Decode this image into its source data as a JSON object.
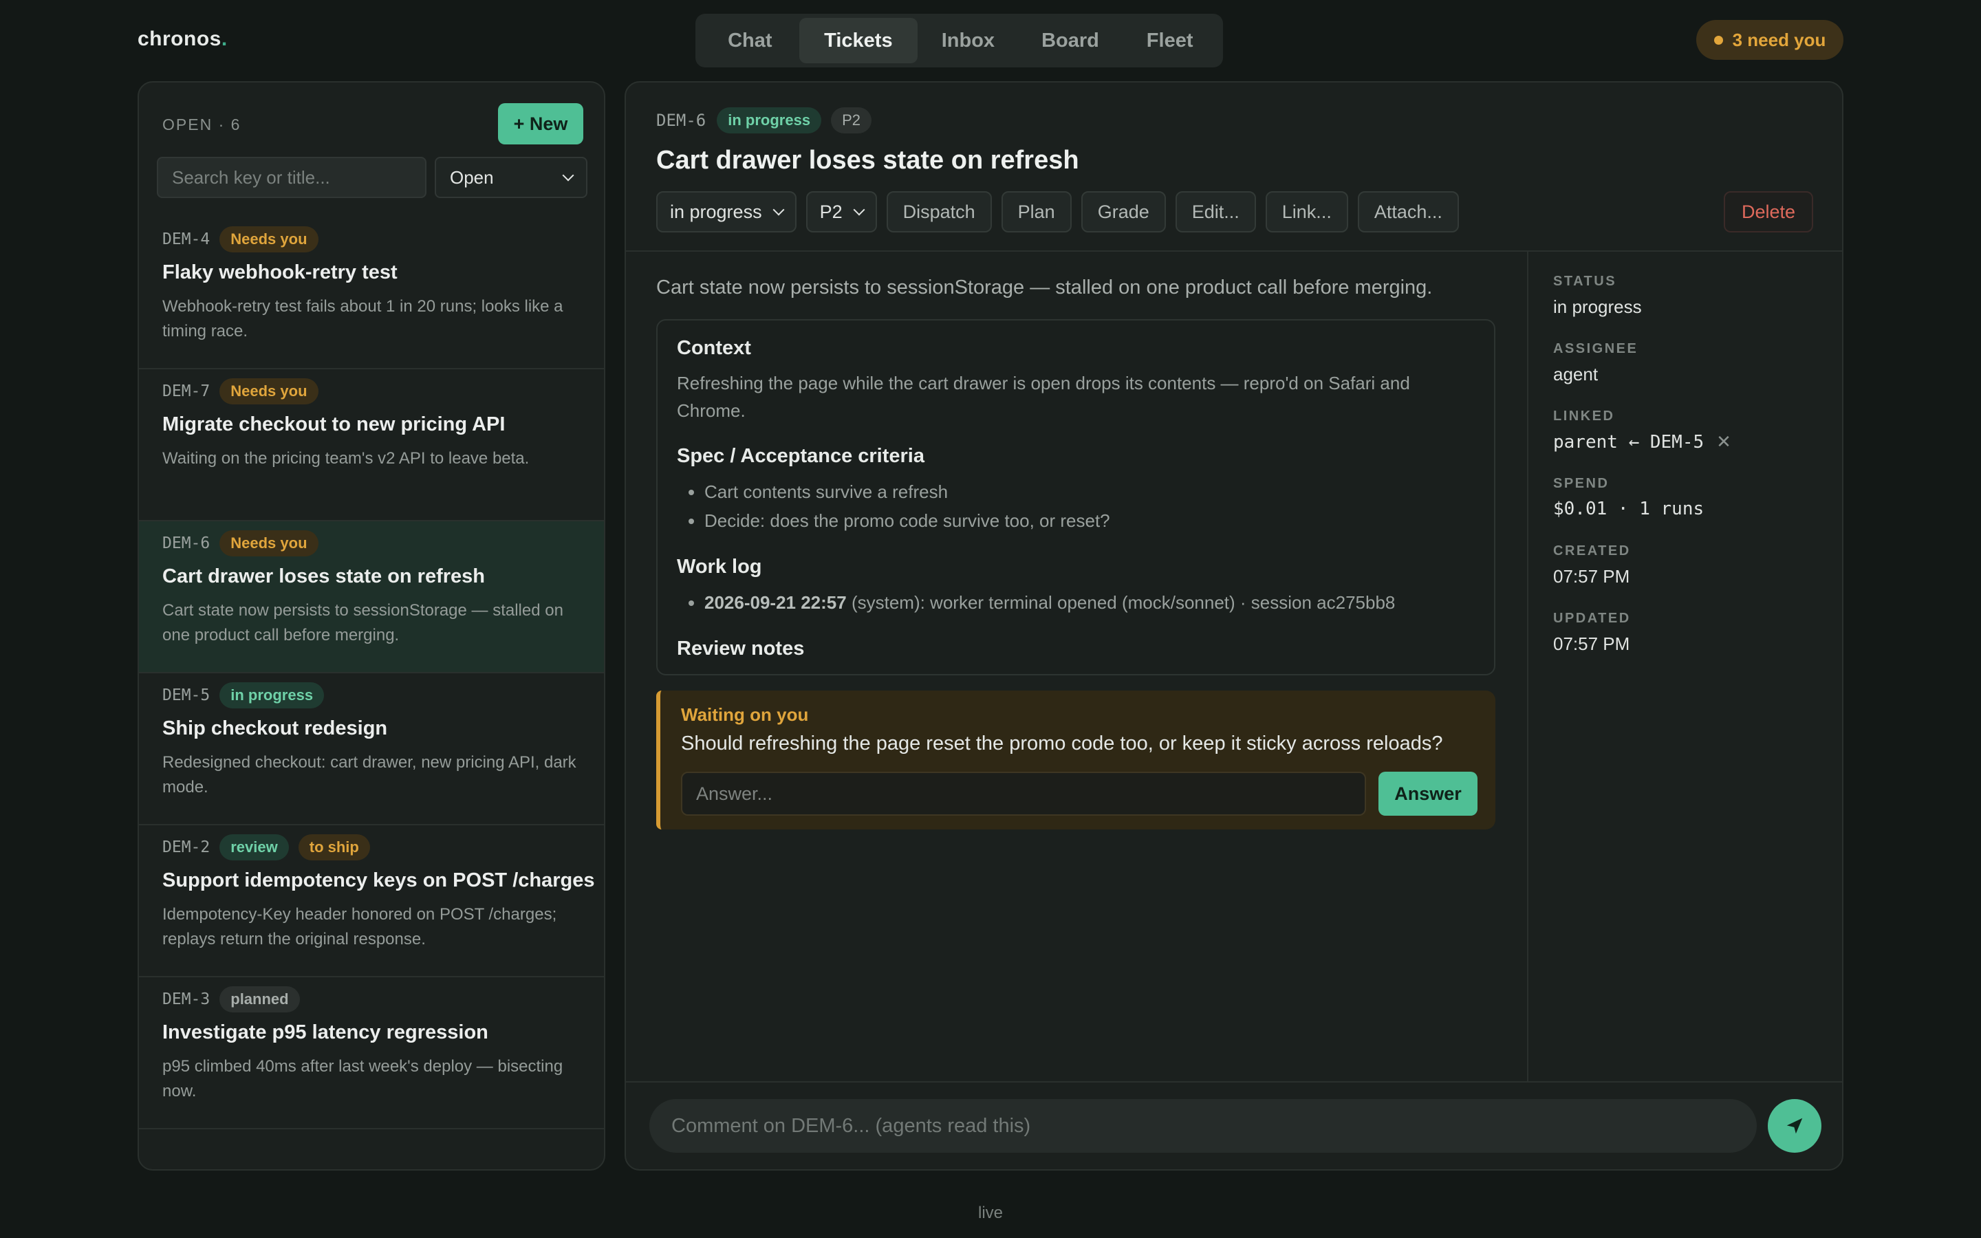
{
  "app": {
    "logo": "chronos",
    "logo_dot": "."
  },
  "nav": {
    "tabs": [
      {
        "label": "Chat"
      },
      {
        "label": "Tickets"
      },
      {
        "label": "Inbox"
      },
      {
        "label": "Board"
      },
      {
        "label": "Fleet"
      }
    ],
    "active": "Tickets"
  },
  "attention": {
    "label": "3 need you"
  },
  "sidebar": {
    "count_label": "OPEN · 6",
    "new_label": "+ New",
    "search_placeholder": "Search key or title...",
    "filter_value": "Open",
    "tickets": [
      {
        "key": "DEM-4",
        "badges": [
          "Needs you"
        ],
        "title": "Flaky webhook-retry test",
        "desc": "Webhook-retry test fails about 1 in 20 runs; looks like a timing race."
      },
      {
        "key": "DEM-7",
        "badges": [
          "Needs you"
        ],
        "title": "Migrate checkout to new pricing API",
        "desc": "Waiting on the pricing team's v2 API to leave beta."
      },
      {
        "key": "DEM-6",
        "badges": [
          "Needs you"
        ],
        "title": "Cart drawer loses state on refresh",
        "desc": "Cart state now persists to sessionStorage — stalled on one product call before merging."
      },
      {
        "key": "DEM-5",
        "badges": [
          "in progress"
        ],
        "title": "Ship checkout redesign",
        "desc": "Redesigned checkout: cart drawer, new pricing API, dark mode."
      },
      {
        "key": "DEM-2",
        "badges": [
          "review",
          "to ship"
        ],
        "title": "Support idempotency keys on POST /charges",
        "desc": "Idempotency-Key header honored on POST /charges; replays return the original response."
      },
      {
        "key": "DEM-3",
        "badges": [
          "planned"
        ],
        "title": "Investigate p95 latency regression",
        "desc": "p95 climbed 40ms after last week's deploy — bisecting now."
      }
    ]
  },
  "detail": {
    "key": "DEM-6",
    "status_badge": "in progress",
    "priority_badge": "P2",
    "title": "Cart drawer loses state on refresh",
    "status_select": "in progress",
    "priority_select": "P2",
    "actions": {
      "dispatch": "Dispatch",
      "plan": "Plan",
      "grade": "Grade",
      "edit": "Edit...",
      "link": "Link...",
      "attach": "Attach..."
    },
    "delete": "Delete",
    "summary": "Cart state now persists to sessionStorage — stalled on one product call before merging.",
    "context": {
      "heading": "Context",
      "text": "Refreshing the page while the cart drawer is open drops its contents — repro'd on Safari and Chrome."
    },
    "spec": {
      "heading": "Spec / Acceptance criteria",
      "items": [
        "Cart contents survive a refresh",
        "Decide: does the promo code survive too, or reset?"
      ]
    },
    "worklog": {
      "heading": "Work log",
      "entry_time": "2026-09-21 22:57",
      "entry_text": " (system): worker terminal opened (mock/sonnet) · session ac275bb8"
    },
    "review": {
      "heading": "Review notes"
    },
    "waiting": {
      "label": "Waiting on you",
      "question": "Should refreshing the page reset the promo code too, or keep it sticky across reloads?",
      "answer_placeholder": "Answer...",
      "answer_button": "Answer"
    },
    "meta": {
      "status": {
        "label": "STATUS",
        "value": "in progress"
      },
      "assignee": {
        "label": "ASSIGNEE",
        "value": "agent"
      },
      "linked": {
        "label": "LINKED",
        "value": "parent ← DEM-5"
      },
      "spend": {
        "label": "SPEND",
        "value": "$0.01 · 1 runs"
      },
      "created": {
        "label": "CREATED",
        "value": "07:57 PM"
      },
      "updated": {
        "label": "UPDATED",
        "value": "07:57 PM"
      }
    },
    "comment_placeholder": "Comment on DEM-6... (agents read this)"
  },
  "footer": {
    "status": "live"
  },
  "colors": {
    "accent": "#4fbf95",
    "warning": "#e0a53c",
    "danger": "#df6a5c",
    "background": "#131816"
  }
}
